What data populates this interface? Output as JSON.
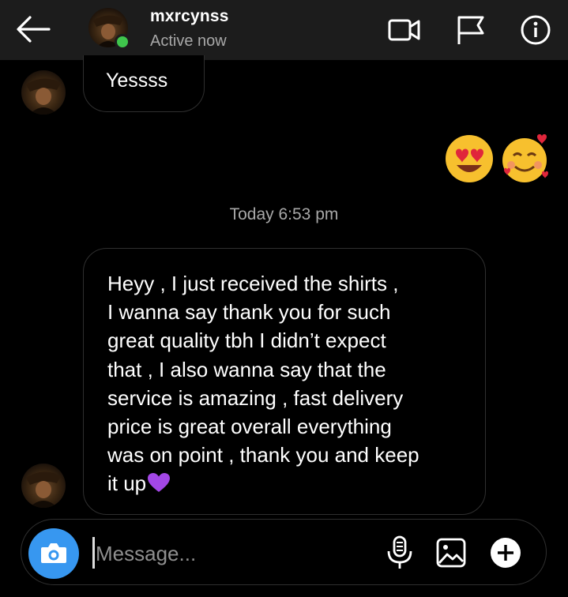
{
  "header": {
    "username": "mxrcynss",
    "status": "Active now",
    "icons": [
      "arrow-left-icon",
      "video-call-icon",
      "flag-icon",
      "info-icon"
    ]
  },
  "messages": [
    {
      "sender": "incoming",
      "text": "Yessss"
    },
    {
      "sender": "outgoing",
      "type": "emoji",
      "emojis": [
        "heart-eyes-face",
        "smiling-face-with-hearts"
      ]
    },
    {
      "type": "timestamp",
      "text": "Today 6:53 pm"
    },
    {
      "sender": "incoming",
      "lines": [
        "Heyy , I just received the shirts ,",
        "I wanna say thank you for such",
        "great quality tbh I didn’t expect",
        "that , I also wanna say that the",
        "service is amazing , fast delivery",
        "price is great overall everything",
        "was on point , thank you and keep",
        "it up"
      ],
      "trailing_emoji": "purple-heart"
    }
  ],
  "composer": {
    "placeholder": "Message...",
    "icons": [
      "camera-icon",
      "microphone-icon",
      "gallery-icon",
      "plus-icon"
    ]
  },
  "colors": {
    "header_bg": "#1c1c1c",
    "camera_button": "#3797f0",
    "active_dot": "#3fc64c",
    "bubble_border": "#2f2f2f",
    "secondary_text": "#a8a8a8"
  }
}
